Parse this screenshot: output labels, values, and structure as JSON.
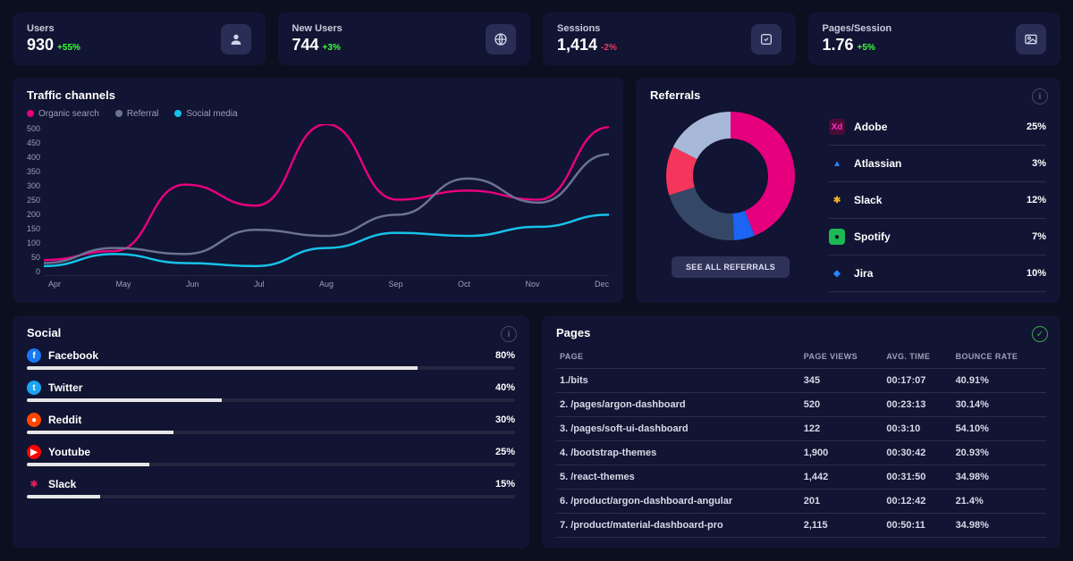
{
  "stats": [
    {
      "label": "Users",
      "value": "930",
      "delta": "+55%",
      "dir": "up",
      "icon": "user-icon"
    },
    {
      "label": "New Users",
      "value": "744",
      "delta": "+3%",
      "dir": "up",
      "icon": "globe-icon"
    },
    {
      "label": "Sessions",
      "value": "1,414",
      "delta": "-2%",
      "dir": "down",
      "icon": "session-icon"
    },
    {
      "label": "Pages/Session",
      "value": "1.76",
      "delta": "+5%",
      "dir": "up",
      "icon": "image-icon"
    }
  ],
  "traffic": {
    "title": "Traffic channels",
    "legend": [
      {
        "label": "Organic search",
        "color": "#e6007e"
      },
      {
        "label": "Referral",
        "color": "#6c7293"
      },
      {
        "label": "Social media",
        "color": "#17c1e8"
      }
    ]
  },
  "referrals": {
    "title": "Referrals",
    "button": "SEE ALL REFERRALS",
    "items": [
      {
        "name": "Adobe",
        "pct": "25%",
        "bg": "#4a0d36",
        "fg": "#ff2bc2",
        "txt": "Xd"
      },
      {
        "name": "Atlassian",
        "pct": "3%",
        "bg": "transparent",
        "fg": "#2684ff",
        "txt": "▲"
      },
      {
        "name": "Slack",
        "pct": "12%",
        "bg": "transparent",
        "fg": "#ecb22e",
        "txt": "✱"
      },
      {
        "name": "Spotify",
        "pct": "7%",
        "bg": "#1db954",
        "fg": "#0b0e20",
        "txt": "●"
      },
      {
        "name": "Jira",
        "pct": "10%",
        "bg": "transparent",
        "fg": "#2684ff",
        "txt": "◆"
      }
    ]
  },
  "social": {
    "title": "Social",
    "items": [
      {
        "name": "Facebook",
        "pct": 80,
        "label": "80%",
        "bg": "#1877f2",
        "fg": "#fff",
        "g": "f"
      },
      {
        "name": "Twitter",
        "pct": 40,
        "label": "40%",
        "bg": "#1da1f2",
        "fg": "#fff",
        "g": "t"
      },
      {
        "name": "Reddit",
        "pct": 30,
        "label": "30%",
        "bg": "#ff4500",
        "fg": "#fff",
        "g": "●"
      },
      {
        "name": "Youtube",
        "pct": 25,
        "label": "25%",
        "bg": "#ff0000",
        "fg": "#fff",
        "g": "▶"
      },
      {
        "name": "Slack",
        "pct": 15,
        "label": "15%",
        "bg": "transparent",
        "fg": "#e01e5a",
        "g": "✱"
      }
    ]
  },
  "pages": {
    "title": "Pages",
    "headers": [
      "PAGE",
      "PAGE VIEWS",
      "AVG. TIME",
      "BOUNCE RATE"
    ],
    "rows": [
      [
        "1./bits",
        "345",
        "00:17:07",
        "40.91%"
      ],
      [
        "2. /pages/argon-dashboard",
        "520",
        "00:23:13",
        "30.14%"
      ],
      [
        "3. /pages/soft-ui-dashboard",
        "122",
        "00:3:10",
        "54.10%"
      ],
      [
        "4. /bootstrap-themes",
        "1,900",
        "00:30:42",
        "20.93%"
      ],
      [
        "5. /react-themes",
        "1,442",
        "00:31:50",
        "34.98%"
      ],
      [
        "6. /product/argon-dashboard-angular",
        "201",
        "00:12:42",
        "21.4%"
      ],
      [
        "7. /product/material-dashboard-pro",
        "2,115",
        "00:50:11",
        "34.98%"
      ]
    ]
  },
  "chart_data": [
    {
      "type": "line",
      "title": "Traffic channels",
      "categories": [
        "Apr",
        "May",
        "Jun",
        "Jul",
        "Aug",
        "Sep",
        "Oct",
        "Nov",
        "Dec"
      ],
      "xlabel": "",
      "ylabel": "",
      "ylim": [
        0,
        500
      ],
      "yticks": [
        0,
        50,
        100,
        150,
        200,
        250,
        300,
        350,
        400,
        450,
        500
      ],
      "series": [
        {
          "name": "Organic search",
          "color": "#e6007e",
          "values": [
            50,
            80,
            300,
            230,
            500,
            250,
            280,
            250,
            490
          ]
        },
        {
          "name": "Referral",
          "color": "#6c7293",
          "values": [
            40,
            90,
            70,
            150,
            130,
            200,
            320,
            240,
            400
          ]
        },
        {
          "name": "Social media",
          "color": "#17c1e8",
          "values": [
            30,
            70,
            40,
            30,
            90,
            140,
            130,
            160,
            200
          ]
        }
      ]
    },
    {
      "type": "pie",
      "title": "Referrals",
      "slices": [
        {
          "name": "Adobe",
          "value": 25,
          "color": "#e6007e"
        },
        {
          "name": "Atlassian",
          "value": 3,
          "color": "#1c64f2"
        },
        {
          "name": "Slack",
          "value": 12,
          "color": "#344767"
        },
        {
          "name": "Spotify",
          "value": 7,
          "color": "#f5365c"
        },
        {
          "name": "Jira",
          "value": 10,
          "color": "#a8b8d8"
        }
      ]
    }
  ]
}
